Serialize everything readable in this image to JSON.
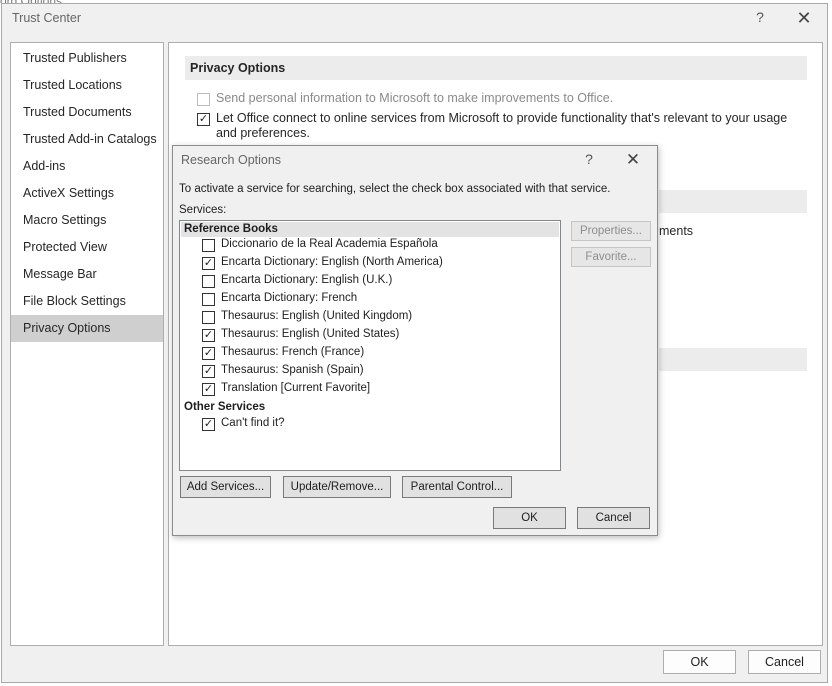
{
  "background": {
    "title_fragment": "ord Options"
  },
  "trust_center": {
    "title": "Trust Center",
    "help": "?",
    "close": "✕",
    "sidebar": [
      {
        "label": "Trusted Publishers"
      },
      {
        "label": "Trusted Locations"
      },
      {
        "label": "Trusted Documents"
      },
      {
        "label": "Trusted Add-in Catalogs"
      },
      {
        "label": "Add-ins"
      },
      {
        "label": "ActiveX Settings"
      },
      {
        "label": "Macro Settings"
      },
      {
        "label": "Protected View"
      },
      {
        "label": "Message Bar"
      },
      {
        "label": "File Block Settings"
      },
      {
        "label": "Privacy Options",
        "selected": true
      }
    ],
    "content": {
      "section_title": "Privacy Options",
      "option1": {
        "label": "Send personal information to Microsoft to make improvements to Office.",
        "checked": false,
        "enabled": false
      },
      "option2": {
        "label": "Let Office connect to online services from Microsoft to provide functionality that's relevant to your usage and preferences.",
        "checked": true
      },
      "clipped_text": "ments"
    },
    "ok_label": "OK",
    "cancel_label": "Cancel"
  },
  "research_options": {
    "title": "Research Options",
    "help": "?",
    "close": "✕",
    "instruction": "To activate a service for searching, select the check box associated with that service.",
    "services_label": "Services:",
    "groups": {
      "reference_books": "Reference Books",
      "other_services": "Other Services"
    },
    "reference_books": [
      {
        "label": "Diccionario de la Real Academia Española",
        "checked": false
      },
      {
        "label": "Encarta Dictionary: English (North America)",
        "checked": true
      },
      {
        "label": "Encarta Dictionary: English (U.K.)",
        "checked": false
      },
      {
        "label": "Encarta Dictionary: French",
        "checked": false
      },
      {
        "label": "Thesaurus: English (United Kingdom)",
        "checked": false
      },
      {
        "label": "Thesaurus: English (United States)",
        "checked": true
      },
      {
        "label": "Thesaurus: French (France)",
        "checked": true
      },
      {
        "label": "Thesaurus: Spanish (Spain)",
        "checked": true
      },
      {
        "label": "Translation  [Current Favorite]",
        "checked": true
      }
    ],
    "other_services": [
      {
        "label": "Can't find it?",
        "checked": true
      }
    ],
    "properties_label": "Properties...",
    "favorite_label": "Favorite...",
    "add_services_label": "Add Services...",
    "update_remove_label": "Update/Remove...",
    "parental_control_label": "Parental Control...",
    "ok_label": "OK",
    "cancel_label": "Cancel"
  }
}
